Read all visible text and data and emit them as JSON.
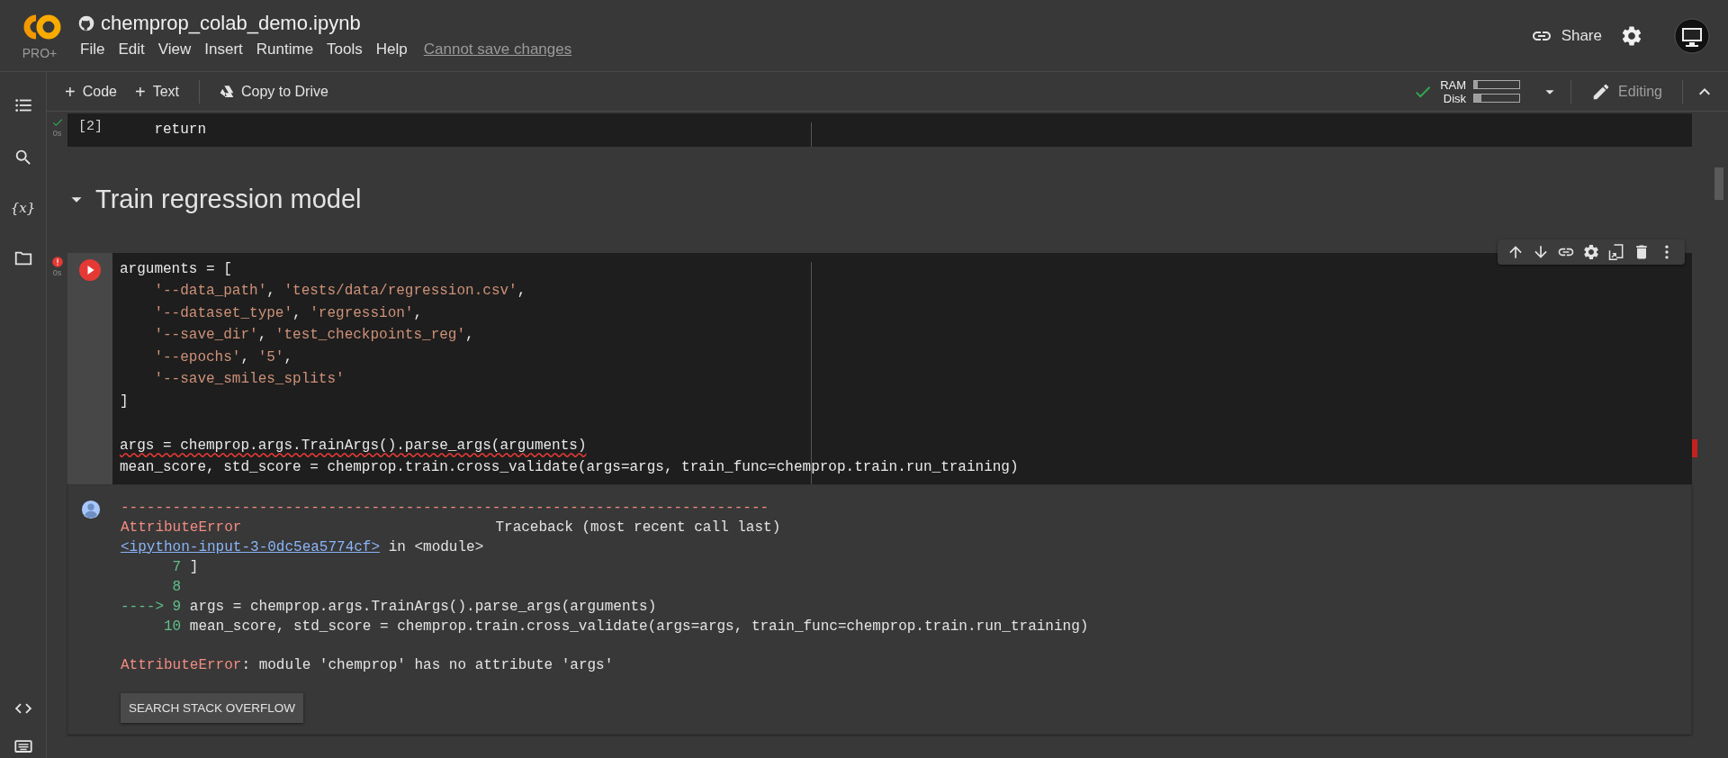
{
  "header": {
    "logo_badge": "PRO+",
    "title": "chemprop_colab_demo.ipynb",
    "menu": [
      "File",
      "Edit",
      "View",
      "Insert",
      "Runtime",
      "Tools",
      "Help"
    ],
    "save_status": "Cannot save changes",
    "share": "Share"
  },
  "toolbar": {
    "buttons": [
      {
        "kind": "add",
        "glyph": "+",
        "label": "Code"
      },
      {
        "kind": "add",
        "glyph": "+",
        "label": "Text"
      },
      {
        "kind": "drive",
        "label": "Copy to Drive"
      }
    ],
    "resources": {
      "connected": true,
      "meters": [
        {
          "label": "RAM",
          "level": 0.08
        },
        {
          "label": "Disk",
          "level": 0.16
        }
      ]
    },
    "mode": "Editing"
  },
  "sidebar": {
    "top": [
      {
        "kind": "toc"
      },
      {
        "kind": "search"
      },
      {
        "kind": "variables",
        "glyph": "{x}"
      },
      {
        "kind": "files"
      }
    ],
    "bottom": [
      {
        "kind": "snippets"
      },
      {
        "kind": "terminal"
      }
    ]
  },
  "cells": [
    {
      "kind": "code",
      "error": false,
      "time": "0s",
      "focused": false,
      "execution_count": "[2]",
      "lines": [
        {
          "kind": "code",
          "text": "    return",
          "squiggle": false
        }
      ]
    },
    {
      "kind": "heading",
      "text": "Train regression model",
      "expanded": true
    },
    {
      "kind": "code",
      "error": true,
      "time": "0s",
      "focused": true,
      "lines": [
        {
          "kind": "code",
          "text": "arguments = [",
          "squiggle": false
        },
        {
          "kind": "code",
          "text": "    '--data_path', 'tests/data/regression.csv',",
          "squiggle": false
        },
        {
          "kind": "code",
          "text": "    '--dataset_type', 'regression',",
          "squiggle": false
        },
        {
          "kind": "code",
          "text": "    '--save_dir', 'test_checkpoints_reg',",
          "squiggle": false
        },
        {
          "kind": "code",
          "text": "    '--epochs', '5',",
          "squiggle": false
        },
        {
          "kind": "code",
          "text": "    '--save_smiles_splits'",
          "squiggle": false
        },
        {
          "kind": "code",
          "text": "]",
          "squiggle": false
        },
        {
          "kind": "blank"
        },
        {
          "kind": "code",
          "text": "args = chemprop.args.TrainArgs().parse_args(arguments)",
          "squiggle": true
        },
        {
          "kind": "code",
          "text": "mean_score, std_score = chemprop.train.cross_validate(args=args, train_func=chemprop.train.run_training)",
          "squiggle": false
        }
      ],
      "output": {
        "lines": [
          {
            "kind": "rule",
            "text": "---------------------------------------------------------------------------"
          },
          {
            "kind": "header",
            "error": "AttributeError",
            "text": "Traceback (most recent call last)"
          },
          {
            "kind": "location",
            "link": "<ipython-input-3-0dc5ea5774cf>",
            "text": "in <module>"
          },
          {
            "kind": "source",
            "number": "7",
            "code": "]"
          },
          {
            "kind": "source",
            "number": "8"
          },
          {
            "kind": "source",
            "arrow": "---->",
            "number": "9",
            "code": "args = chemprop.args.TrainArgs().parse_args(arguments)"
          },
          {
            "kind": "source",
            "number": "10",
            "code": "mean_score, std_score = chemprop.train.cross_validate(args=args, train_func=chemprop.train.run_training)"
          },
          {
            "kind": "blank"
          },
          {
            "kind": "error",
            "error": "AttributeError",
            "text": ": module 'chemprop' has no attribute 'args'"
          }
        ],
        "button": "SEARCH STACK OVERFLOW"
      }
    }
  ]
}
